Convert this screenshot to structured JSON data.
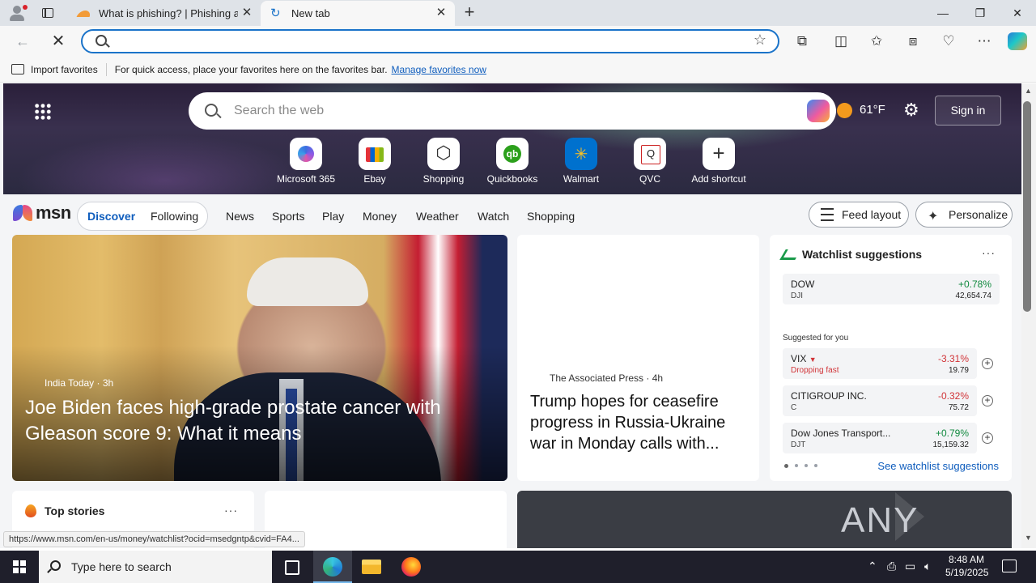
{
  "browser": {
    "tabs": [
      {
        "title": "What is phishing? | Phishing atta"
      },
      {
        "title": "New tab"
      }
    ],
    "address": {
      "value": "",
      "placeholder": ""
    },
    "favorites_bar": {
      "import_label": "Import favorites",
      "message": "For quick access, place your favorites here on the favorites bar.",
      "link": "Manage favorites now"
    },
    "status_url": "https://www.msn.com/en-us/money/watchlist?ocid=msedgntp&cvid=FA4..."
  },
  "newtab": {
    "search_placeholder": "Search the web",
    "weather_temp": "61°F",
    "sign_in": "Sign in",
    "shortcuts": [
      {
        "label": "Microsoft 365",
        "icon": "microsoft-365-icon"
      },
      {
        "label": "Ebay",
        "icon": "ebay-icon"
      },
      {
        "label": "Shopping",
        "icon": "shopping-tag-icon"
      },
      {
        "label": "Quickbooks",
        "icon": "quickbooks-icon"
      },
      {
        "label": "Walmart",
        "icon": "walmart-icon"
      },
      {
        "label": "QVC",
        "icon": "qvc-icon"
      },
      {
        "label": "Add shortcut",
        "icon": "plus-icon"
      }
    ]
  },
  "msn": {
    "logo": "msn",
    "feed_tabs": [
      "Discover",
      "Following"
    ],
    "nav": [
      "News",
      "Sports",
      "Play",
      "Money",
      "Weather",
      "Watch",
      "Shopping"
    ],
    "feed_layout": "Feed layout",
    "personalize": "Personalize",
    "lead_story": {
      "source": "India Today",
      "age": "3h",
      "headline": "Joe Biden faces high-grade prostate cancer with Gleason score 9: What it means"
    },
    "second_story": {
      "source": "The Associated Press",
      "age": "4h",
      "headline": "Trump hopes for ceasefire progress in Russia-Ukraine war in Monday calls with..."
    },
    "watchlist": {
      "title": "Watchlist suggestions",
      "main": {
        "name": "DOW",
        "symbol": "DJI",
        "change": "+0.78%",
        "price": "42,654.74"
      },
      "suggested_label": "Suggested for you",
      "suggested": [
        {
          "name": "VIX",
          "symbol": "",
          "note": "Dropping fast",
          "change": "-3.31%",
          "price": "19.79",
          "direction": "down"
        },
        {
          "name": "CITIGROUP INC.",
          "symbol": "C",
          "note": "",
          "change": "-0.32%",
          "price": "75.72",
          "direction": "down"
        },
        {
          "name": "Dow Jones Transport...",
          "symbol": "DJT",
          "note": "",
          "change": "+0.79%",
          "price": "15,159.32",
          "direction": "up"
        }
      ],
      "see_all": "See watchlist suggestions"
    },
    "top_stories": "Top stories",
    "watermark": "ANY RUN"
  },
  "taskbar": {
    "search_placeholder": "Type here to search",
    "time": "8:48 AM",
    "date": "5/19/2025"
  },
  "colors": {
    "accent": "#0f5dbd",
    "up": "#10893e",
    "down": "#d13438"
  }
}
